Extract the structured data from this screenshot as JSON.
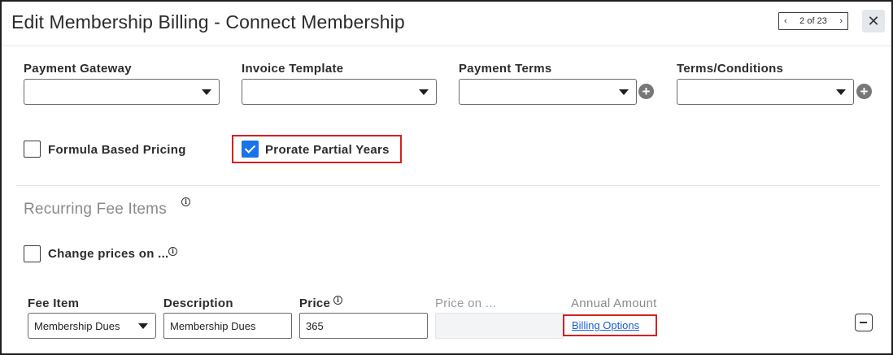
{
  "dialog": {
    "title": "Edit Membership Billing - Connect Membership",
    "pager": {
      "prev_icon": "chevron-left-icon",
      "text": "2 of 23",
      "next_icon": "chevron-right-icon"
    },
    "close_icon": "close-icon"
  },
  "fields": {
    "payment_gateway": {
      "label": "Payment Gateway",
      "value": ""
    },
    "invoice_template": {
      "label": "Invoice Template",
      "value": ""
    },
    "payment_terms": {
      "label": "Payment Terms",
      "value": "",
      "add_icon": "plus-circle-icon"
    },
    "terms_conditions": {
      "label": "Terms/Conditions",
      "value": "",
      "add_icon": "plus-circle-icon"
    }
  },
  "options": {
    "formula_based_pricing": {
      "label": "Formula Based Pricing",
      "checked": false
    },
    "prorate_partial_years": {
      "label": "Prorate Partial Years",
      "checked": true
    }
  },
  "recurring": {
    "title": "Recurring Fee Items",
    "info_icon": "info-icon",
    "change_prices": {
      "label": "Change prices on ...",
      "checked": false
    },
    "columns": {
      "fee_item": "Fee Item",
      "description": "Description",
      "price": "Price",
      "price_on": "Price on ...",
      "annual_amount": "Annual Amount"
    },
    "row": {
      "fee_item": "Membership Dues",
      "description": "Membership Dues",
      "price": "365",
      "price_on": "",
      "billing_options_link": "Billing Options",
      "remove_icon": "minus-icon"
    }
  },
  "colors": {
    "accent": "#1a73e8",
    "highlight": "#d42020",
    "link": "#1a5fd0"
  }
}
